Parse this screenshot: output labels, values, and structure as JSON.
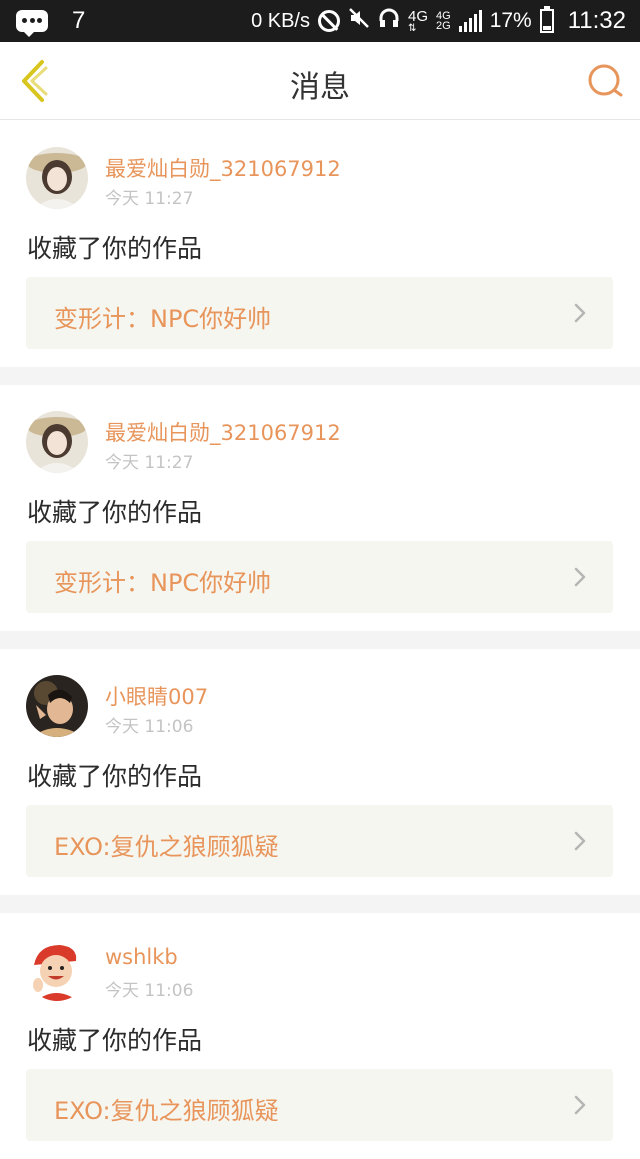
{
  "status_bar": {
    "notification_count": "7",
    "net_speed": "0 KB/s",
    "network_primary": "4G",
    "network_secondary_top": "4G",
    "network_secondary_bottom": "2G",
    "battery": "17%",
    "time": "11:32"
  },
  "header": {
    "title": "消息"
  },
  "messages": [
    {
      "user": "最爱灿白勋_321067912",
      "time": "今天 11:27",
      "action": "收藏了你的作品",
      "work": "变形计：NPC你好帅",
      "avatar_icon": "avatar-girl-hat"
    },
    {
      "user": "最爱灿白勋_321067912",
      "time": "今天 11:27",
      "action": "收藏了你的作品",
      "work": "变形计：NPC你好帅",
      "avatar_icon": "avatar-girl-hat"
    },
    {
      "user": "小眼睛007",
      "time": "今天 11:06",
      "action": "收藏了你的作品",
      "work": "EXO:复仇之狼顾狐疑",
      "avatar_icon": "avatar-photo-dark"
    },
    {
      "user": "wshlkb",
      "time": "今天 11:06",
      "action": "收藏了你的作品",
      "work": "EXO:复仇之狼顾狐疑",
      "avatar_icon": "avatar-cartoon-boy"
    }
  ],
  "colors": {
    "accent": "#e8955b",
    "back_arrow": "#d8c61e",
    "work_bg": "#f6f6f0"
  }
}
